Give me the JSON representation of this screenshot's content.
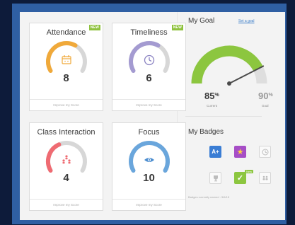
{
  "cards": [
    {
      "title": "Attendance",
      "value": "8",
      "color": "#f0a93a",
      "level": 0.62,
      "icon": "calendar-icon",
      "badge": "NEW",
      "footer": "Improve my Score"
    },
    {
      "title": "Timeliness",
      "value": "6",
      "color": "#a49bd1",
      "level": 0.62,
      "icon": "clock-icon",
      "badge": "NEW",
      "footer": "Improve my Score"
    },
    {
      "title": "Class Interaction",
      "value": "4",
      "color": "#ef6b72",
      "level": 0.4,
      "icon": "group-icon",
      "footer": "Improve my Score"
    },
    {
      "title": "Focus",
      "value": "10",
      "color": "#6aa6dc",
      "level": 1.0,
      "icon": "eye-icon",
      "footer": "Improve my Score"
    }
  ],
  "goal": {
    "title": "My Goal",
    "link": "Set a goal",
    "current": "85",
    "current_label": "Current",
    "target": "90",
    "target_label": "Goal",
    "percent_sign": "%",
    "level": 0.85,
    "color": "#8cc63f"
  },
  "badges": {
    "title": "My Badges",
    "items": [
      {
        "name": "a-plus",
        "label": "A+",
        "color": "#3a7dd4",
        "earned": true
      },
      {
        "name": "star",
        "color": "#a64ec6",
        "earned": true
      },
      {
        "name": "clock",
        "earned": false
      },
      {
        "name": "trophy",
        "earned": false
      },
      {
        "name": "check",
        "color": "#8cc63f",
        "earned": true,
        "new": "New"
      },
      {
        "name": "group",
        "earned": false
      }
    ],
    "note": "Badges currently earned : 3/6/15"
  }
}
